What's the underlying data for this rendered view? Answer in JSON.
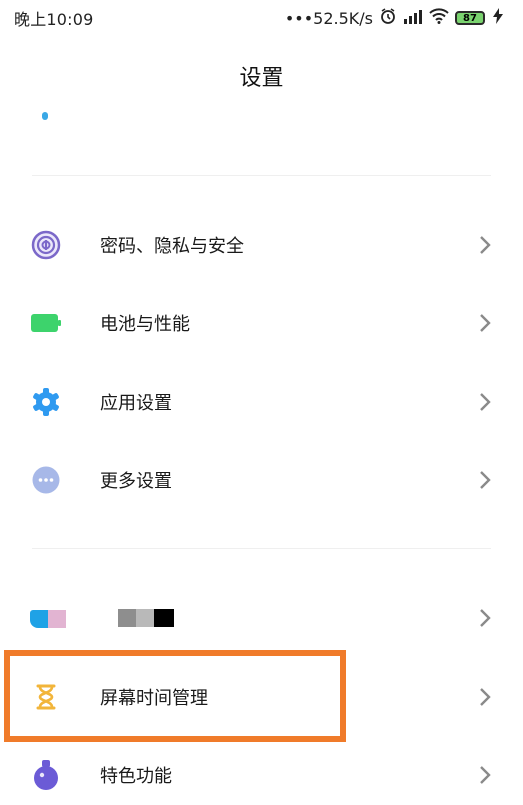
{
  "status_bar": {
    "time": "晚上10:09",
    "network_speed": "•••52.5K/s",
    "battery_level": "87"
  },
  "header": {
    "title": "设置"
  },
  "settings": {
    "security": "密码、隐私与安全",
    "battery": "电池与性能",
    "app_settings": "应用设置",
    "more_settings": "更多设置",
    "screen_time": "屏幕时间管理",
    "special_features": "特色功能"
  },
  "colors": {
    "highlight": "#f07b2a",
    "security_icon": "#7b68c9",
    "battery_icon": "#3dd36c",
    "app_icon": "#2f9af0",
    "more_icon": "#a7b8e8",
    "screen_time_icon": "#f2b53a",
    "special_icon": "#6b5bd6"
  }
}
